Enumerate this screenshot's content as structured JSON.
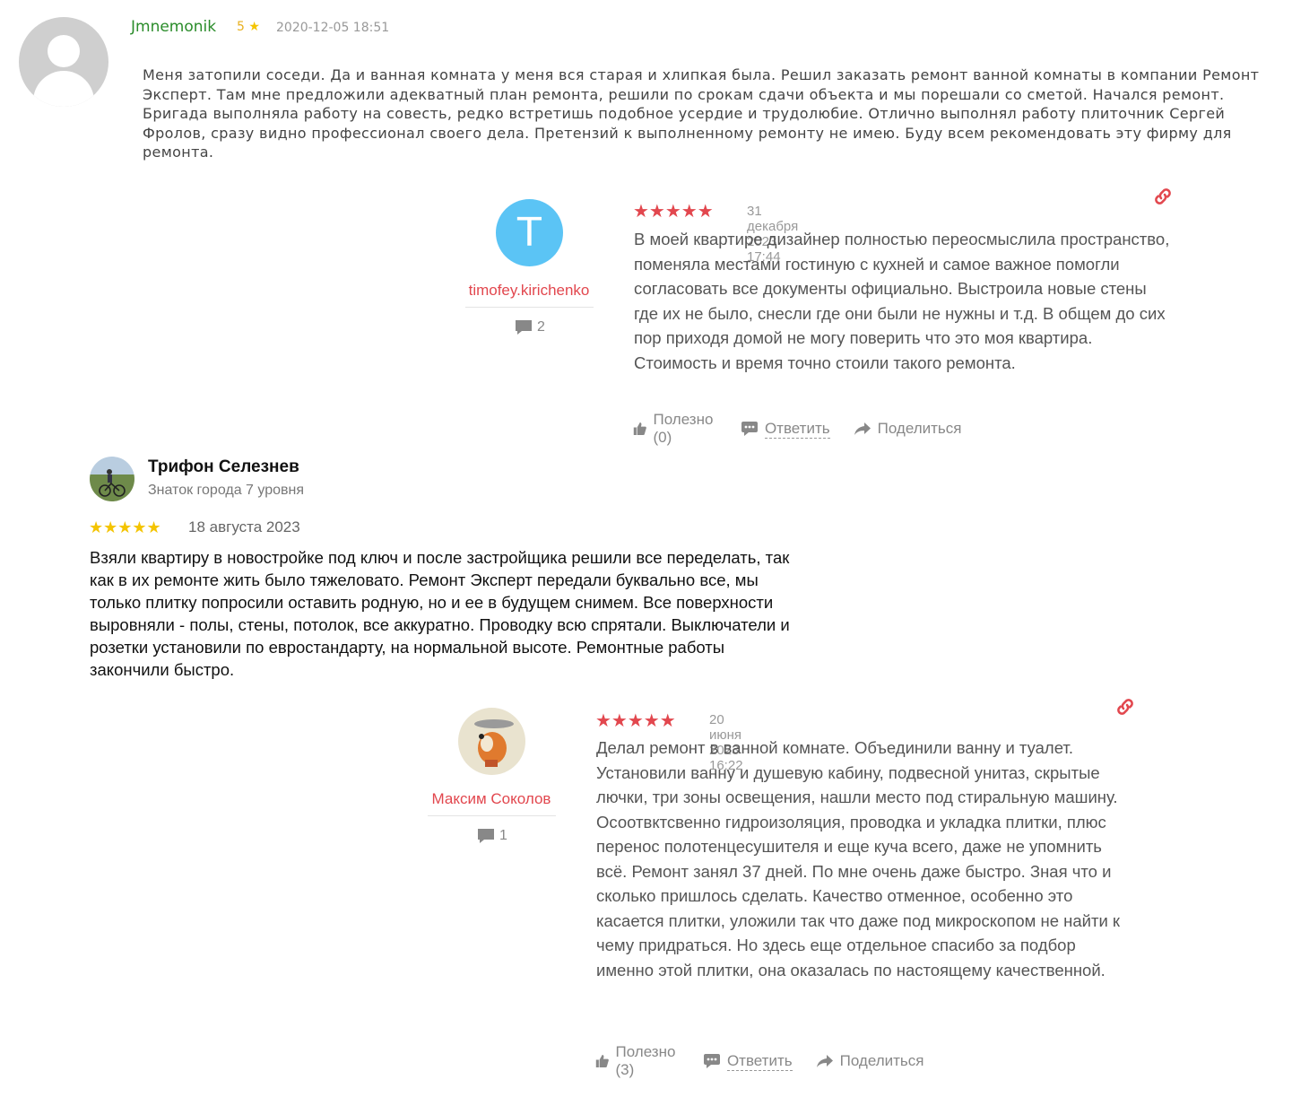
{
  "review1": {
    "author": "Jmnemonik",
    "rating": "5",
    "star": "★",
    "date": "2020-12-05 18:51",
    "text": "Меня затопили соседи. Да и ванная комната у меня вся старая и хлипкая была. Решил заказать ремонт ванной комнаты в компании Ремонт Эксперт. Там мне предложили адекватный план ремонта, решили по срокам сдачи объекта и мы порешали со сметой. Начался ремонт. Бригада выполняла работу на совесть, редко встретишь подобное усердие и трудолюбие. Отлично выполнял работу плиточник Сергей Фролов, сразу видно профессионал своего дела. Претензий к выполненному ремонту не имею. Буду всем рекомендовать эту фирму для ремонта."
  },
  "review2": {
    "avatar_letter": "T",
    "avatar_color": "#5bc4f5",
    "user": "timofey.kirichenko",
    "comments": "2",
    "stars": "★★★★★",
    "date": "31 декабря 2023 17:44",
    "text": "В моей квартире дизайнер полностью переосмыслила пространство, поменяла местами гостиную с кухней и самое важное помогли согласовать все документы официально. Выстроила новые стены где их не было, снесли где они были не нужны и т.д. В общем до сих пор приходя домой не могу поверить что это моя квартира. Стоимость и время точно стоили такого ремонта.",
    "useful": "Полезно (0)",
    "reply": "Ответить",
    "share": "Поделиться"
  },
  "review3": {
    "name": "Трифон Селезнев",
    "level": "Знаток города 7 уровня",
    "stars": "★★★★★",
    "date": "18 августа 2023",
    "text": "Взяли квартиру в новостройке под ключ и после застройщика решили все переделать, так как в их ремонте жить было тяжеловато. Ремонт Эксперт передали буквально все, мы только плитку попросили оставить родную, но и ее в будущем снимем. Все поверхности выровняли - полы, стены, потолок, все аккуратно. Проводку всю спрятали. Выключатели и розетки установили по евростандарту, на нормальной высоте. Ремонтные работы закончили быстро."
  },
  "review4": {
    "user": "Максим Соколов",
    "comments": "1",
    "stars": "★★★★★",
    "date": "20 июня 2023 16:22",
    "text": "Делал ремонт в ванной комнате. Объединили ванну и туалет. Установили ванну и душевую кабину, подвесной унитаз, скрытые лючки, три зоны освещения, нашли место под стиральную машину. Осоотвктсвенно гидроизоляция, проводка и укладка плитки, плюс перенос полотенцесушителя и еще куча всего, даже не упомнить всё. Ремонт занял 37 дней. По мне очень даже быстро. Зная что и сколько пришлось сделать. Качество отменное, особенно это касается плитки, уложили так что даже под микроскопом не найти к чему придраться. Но здесь еще отдельное спасибо за подбор именно этой плитки, она оказалась по настоящему качественной.",
    "useful": "Полезно (3)",
    "reply": "Ответить",
    "share": "Поделиться"
  },
  "colors": {
    "accent_red": "#e2474e",
    "author_green": "#2a8c2a",
    "star_yellow": "#f4c400"
  }
}
